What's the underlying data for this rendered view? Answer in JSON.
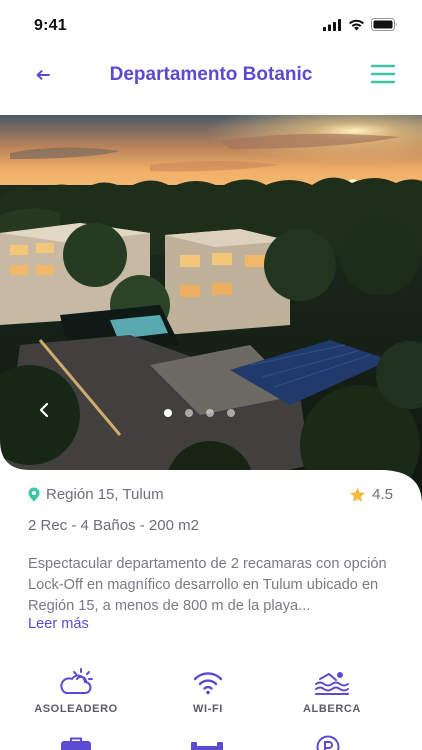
{
  "status": {
    "time": "9:41"
  },
  "header": {
    "title": "Departamento Botanic"
  },
  "hero": {
    "slide_count": 4,
    "active_slide": 1
  },
  "property": {
    "location": "Región 15, Tulum",
    "rating": "4.5",
    "specs": "2 Rec -  4 Baños  -  200 m2",
    "description": "Espectacular departamento de 2 recamaras con opción Lock-Off en magnífico desarrollo en Tulum ubicado en Región 15, a menos de 800 m de la playa...",
    "read_more": "Leer más"
  },
  "amenities": [
    {
      "label": "ASOLEADERO",
      "icon": "sun-cloud-icon"
    },
    {
      "label": "WI-FI",
      "icon": "wifi-icon"
    },
    {
      "label": "ALBERCA",
      "icon": "pool-icon"
    }
  ],
  "colors": {
    "accent": "#5b4bd0",
    "menu": "#3cc5a6",
    "location_pin": "#3cc5a6",
    "star": "#f5b83d"
  }
}
